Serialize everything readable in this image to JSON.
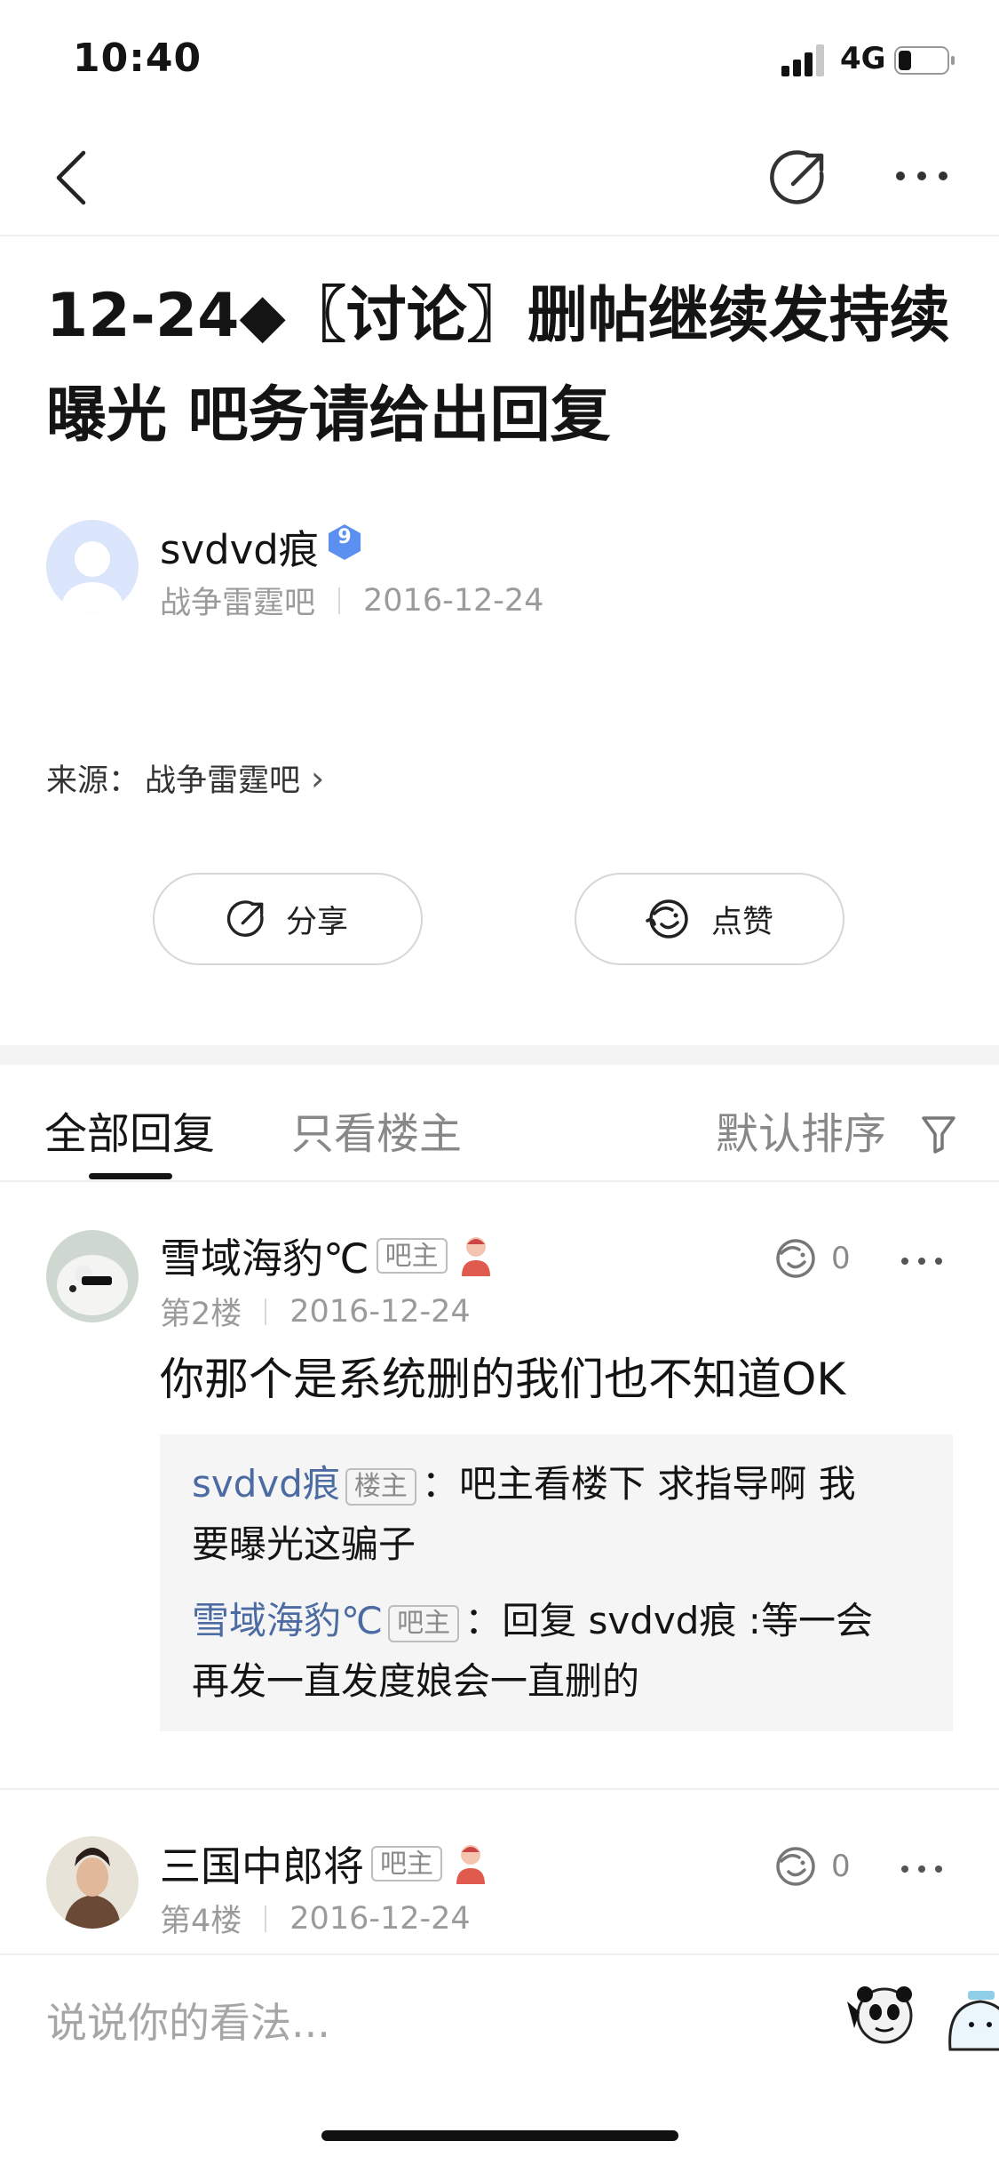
{
  "status_bar": {
    "time": "10:40",
    "network": "4G"
  },
  "nav": {
    "back_icon": "chevron-left-icon",
    "share_icon": "share-icon",
    "more_icon": "more-horizontal-icon"
  },
  "post": {
    "title": "12-24◆〖讨论〗删帖继续发持续曝光  吧务请给出回复",
    "author": {
      "name": "svdvd痕",
      "level": "9",
      "forum": "战争雷霆吧",
      "date": "2016-12-24"
    },
    "source_label": "来源：",
    "source_forum": "战争雷霆吧",
    "source_chevron": "›",
    "share_label": "分享",
    "like_label": "点赞"
  },
  "tabs": {
    "all": "全部回复",
    "op_only": "只看楼主",
    "sort": "默认排序"
  },
  "replies": [
    {
      "name": "雪域海豹℃",
      "role": "吧主",
      "floor": "第2楼",
      "date": "2016-12-24",
      "likes": "0",
      "content": "你那个是系统删的我们也不知道OK",
      "sub_replies": [
        {
          "name": "svdvd痕",
          "role": "楼主",
          "colon": "：",
          "text_line1": "吧主看楼下 求指导啊 我",
          "text_line2": "要曝光这骗子"
        },
        {
          "name": "雪域海豹℃",
          "role": "吧主",
          "colon": "：",
          "text_line1": "回复 svdvd痕 :等一会",
          "text_line2": "再发一直发度娘会一直删的"
        }
      ]
    },
    {
      "name": "三国中郎将",
      "role": "吧主",
      "floor": "第4楼",
      "date": "2016-12-24",
      "likes": "0"
    }
  ],
  "composer": {
    "placeholder": "说说你的看法..."
  },
  "colors": {
    "link_blue": "#4c6ba3",
    "badge_blue": "#5b8ff0",
    "text": "#141414",
    "muted": "#9b9b9b"
  }
}
